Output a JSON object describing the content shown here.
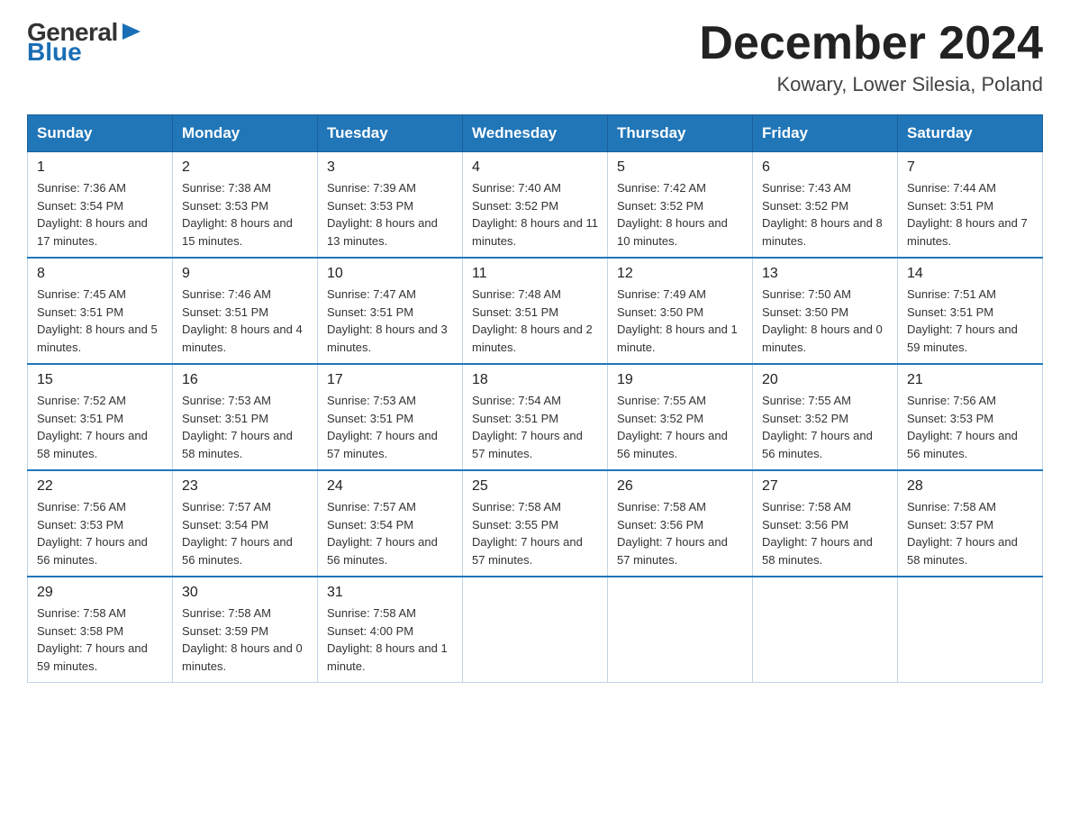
{
  "logo": {
    "general": "General",
    "blue": "Blue",
    "arrow": "▶"
  },
  "title": "December 2024",
  "location": "Kowary, Lower Silesia, Poland",
  "header_days": [
    "Sunday",
    "Monday",
    "Tuesday",
    "Wednesday",
    "Thursday",
    "Friday",
    "Saturday"
  ],
  "weeks": [
    [
      {
        "day": "1",
        "sunrise": "7:36 AM",
        "sunset": "3:54 PM",
        "daylight": "8 hours and 17 minutes."
      },
      {
        "day": "2",
        "sunrise": "7:38 AM",
        "sunset": "3:53 PM",
        "daylight": "8 hours and 15 minutes."
      },
      {
        "day": "3",
        "sunrise": "7:39 AM",
        "sunset": "3:53 PM",
        "daylight": "8 hours and 13 minutes."
      },
      {
        "day": "4",
        "sunrise": "7:40 AM",
        "sunset": "3:52 PM",
        "daylight": "8 hours and 11 minutes."
      },
      {
        "day": "5",
        "sunrise": "7:42 AM",
        "sunset": "3:52 PM",
        "daylight": "8 hours and 10 minutes."
      },
      {
        "day": "6",
        "sunrise": "7:43 AM",
        "sunset": "3:52 PM",
        "daylight": "8 hours and 8 minutes."
      },
      {
        "day": "7",
        "sunrise": "7:44 AM",
        "sunset": "3:51 PM",
        "daylight": "8 hours and 7 minutes."
      }
    ],
    [
      {
        "day": "8",
        "sunrise": "7:45 AM",
        "sunset": "3:51 PM",
        "daylight": "8 hours and 5 minutes."
      },
      {
        "day": "9",
        "sunrise": "7:46 AM",
        "sunset": "3:51 PM",
        "daylight": "8 hours and 4 minutes."
      },
      {
        "day": "10",
        "sunrise": "7:47 AM",
        "sunset": "3:51 PM",
        "daylight": "8 hours and 3 minutes."
      },
      {
        "day": "11",
        "sunrise": "7:48 AM",
        "sunset": "3:51 PM",
        "daylight": "8 hours and 2 minutes."
      },
      {
        "day": "12",
        "sunrise": "7:49 AM",
        "sunset": "3:50 PM",
        "daylight": "8 hours and 1 minute."
      },
      {
        "day": "13",
        "sunrise": "7:50 AM",
        "sunset": "3:50 PM",
        "daylight": "8 hours and 0 minutes."
      },
      {
        "day": "14",
        "sunrise": "7:51 AM",
        "sunset": "3:51 PM",
        "daylight": "7 hours and 59 minutes."
      }
    ],
    [
      {
        "day": "15",
        "sunrise": "7:52 AM",
        "sunset": "3:51 PM",
        "daylight": "7 hours and 58 minutes."
      },
      {
        "day": "16",
        "sunrise": "7:53 AM",
        "sunset": "3:51 PM",
        "daylight": "7 hours and 58 minutes."
      },
      {
        "day": "17",
        "sunrise": "7:53 AM",
        "sunset": "3:51 PM",
        "daylight": "7 hours and 57 minutes."
      },
      {
        "day": "18",
        "sunrise": "7:54 AM",
        "sunset": "3:51 PM",
        "daylight": "7 hours and 57 minutes."
      },
      {
        "day": "19",
        "sunrise": "7:55 AM",
        "sunset": "3:52 PM",
        "daylight": "7 hours and 56 minutes."
      },
      {
        "day": "20",
        "sunrise": "7:55 AM",
        "sunset": "3:52 PM",
        "daylight": "7 hours and 56 minutes."
      },
      {
        "day": "21",
        "sunrise": "7:56 AM",
        "sunset": "3:53 PM",
        "daylight": "7 hours and 56 minutes."
      }
    ],
    [
      {
        "day": "22",
        "sunrise": "7:56 AM",
        "sunset": "3:53 PM",
        "daylight": "7 hours and 56 minutes."
      },
      {
        "day": "23",
        "sunrise": "7:57 AM",
        "sunset": "3:54 PM",
        "daylight": "7 hours and 56 minutes."
      },
      {
        "day": "24",
        "sunrise": "7:57 AM",
        "sunset": "3:54 PM",
        "daylight": "7 hours and 56 minutes."
      },
      {
        "day": "25",
        "sunrise": "7:58 AM",
        "sunset": "3:55 PM",
        "daylight": "7 hours and 57 minutes."
      },
      {
        "day": "26",
        "sunrise": "7:58 AM",
        "sunset": "3:56 PM",
        "daylight": "7 hours and 57 minutes."
      },
      {
        "day": "27",
        "sunrise": "7:58 AM",
        "sunset": "3:56 PM",
        "daylight": "7 hours and 58 minutes."
      },
      {
        "day": "28",
        "sunrise": "7:58 AM",
        "sunset": "3:57 PM",
        "daylight": "7 hours and 58 minutes."
      }
    ],
    [
      {
        "day": "29",
        "sunrise": "7:58 AM",
        "sunset": "3:58 PM",
        "daylight": "7 hours and 59 minutes."
      },
      {
        "day": "30",
        "sunrise": "7:58 AM",
        "sunset": "3:59 PM",
        "daylight": "8 hours and 0 minutes."
      },
      {
        "day": "31",
        "sunrise": "7:58 AM",
        "sunset": "4:00 PM",
        "daylight": "8 hours and 1 minute."
      },
      null,
      null,
      null,
      null
    ]
  ]
}
